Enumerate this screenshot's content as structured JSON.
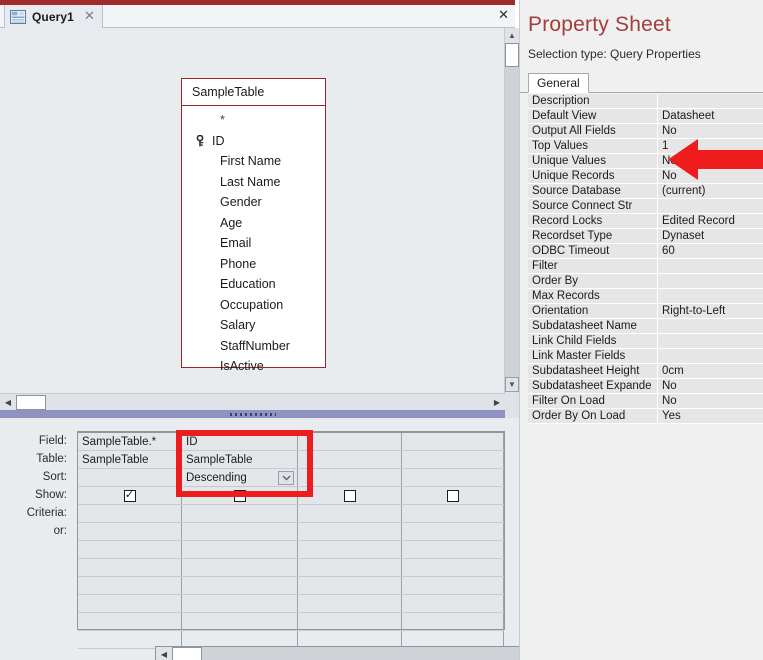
{
  "window": {
    "accent_color": "#a02b2b",
    "close_label": "✕"
  },
  "document_tab": {
    "label": "Query1",
    "icon": "query-design-icon",
    "close_label": "✕"
  },
  "canvas": {
    "field_list": {
      "title": "SampleTable",
      "fields": [
        {
          "name": "*",
          "key": false
        },
        {
          "name": "ID",
          "key": true
        },
        {
          "name": "First Name",
          "key": false
        },
        {
          "name": "Last Name",
          "key": false
        },
        {
          "name": "Gender",
          "key": false
        },
        {
          "name": "Age",
          "key": false
        },
        {
          "name": "Email",
          "key": false
        },
        {
          "name": "Phone",
          "key": false
        },
        {
          "name": "Education",
          "key": false
        },
        {
          "name": "Occupation",
          "key": false
        },
        {
          "name": "Salary",
          "key": false
        },
        {
          "name": "StaffNumber",
          "key": false
        },
        {
          "name": "IsActive",
          "key": false
        }
      ]
    }
  },
  "grid": {
    "row_labels": [
      "Field:",
      "Table:",
      "Sort:",
      "Show:",
      "Criteria:",
      "or:"
    ],
    "columns": [
      {
        "field": "SampleTable.*",
        "table": "SampleTable",
        "sort": "",
        "show": true,
        "criteria": "",
        "or": ""
      },
      {
        "field": "ID",
        "table": "SampleTable",
        "sort": "Descending",
        "show": false,
        "criteria": "",
        "or": ""
      },
      {
        "field": "",
        "table": "",
        "sort": "",
        "show": false,
        "criteria": "",
        "or": ""
      },
      {
        "field": "",
        "table": "",
        "sort": "",
        "show": false,
        "criteria": "",
        "or": ""
      }
    ],
    "checked_glyph": "✓",
    "sort_dropdown_glyph": "⌵"
  },
  "property_sheet": {
    "title": "Property Sheet",
    "subtitle": "Selection type:  Query Properties",
    "tab": "General",
    "properties": [
      {
        "name": "Description",
        "value": ""
      },
      {
        "name": "Default View",
        "value": "Datasheet"
      },
      {
        "name": "Output All Fields",
        "value": "No"
      },
      {
        "name": "Top Values",
        "value": "1"
      },
      {
        "name": "Unique Values",
        "value": "No"
      },
      {
        "name": "Unique Records",
        "value": "No"
      },
      {
        "name": "Source Database",
        "value": "(current)"
      },
      {
        "name": "Source Connect Str",
        "value": ""
      },
      {
        "name": "Record Locks",
        "value": "Edited Record"
      },
      {
        "name": "Recordset Type",
        "value": "Dynaset"
      },
      {
        "name": "ODBC Timeout",
        "value": "60"
      },
      {
        "name": "Filter",
        "value": ""
      },
      {
        "name": "Order By",
        "value": ""
      },
      {
        "name": "Max Records",
        "value": ""
      },
      {
        "name": "Orientation",
        "value": "Right-to-Left"
      },
      {
        "name": "Subdatasheet Name",
        "value": ""
      },
      {
        "name": "Link Child Fields",
        "value": ""
      },
      {
        "name": "Link Master Fields",
        "value": ""
      },
      {
        "name": "Subdatasheet Height",
        "value": "0cm"
      },
      {
        "name": "Subdatasheet Expande",
        "value": "No"
      },
      {
        "name": "Filter On Load",
        "value": "No"
      },
      {
        "name": "Order By On Load",
        "value": "Yes"
      }
    ]
  },
  "annotations": {
    "arrow_color": "#ee1c1c",
    "highlight_color": "#ee1c1c"
  },
  "scrollbars": {
    "left_arrow": "◀",
    "right_arrow": "▶",
    "up_arrow": "▲",
    "down_arrow": "▼"
  }
}
